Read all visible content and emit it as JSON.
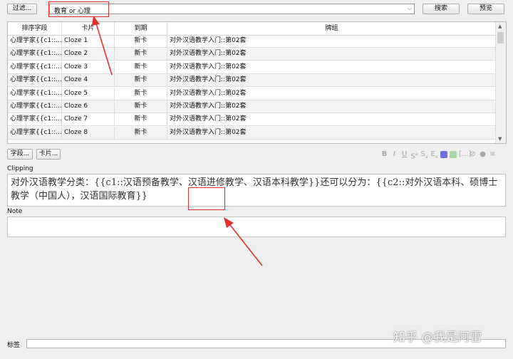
{
  "toolbar": {
    "filter_label": "过滤...",
    "search_value": "教育 or 心理",
    "search_button": "搜索",
    "preview_button": "预览"
  },
  "table": {
    "columns": [
      "排序字段",
      "卡片",
      "到期",
      "牌组"
    ],
    "rows": [
      {
        "sort": "心理学家{{c1::...",
        "card": "Cloze 1",
        "due": "新卡",
        "deck": "对外汉语教学入门::第02套"
      },
      {
        "sort": "心理学家{{c1::...",
        "card": "Cloze 2",
        "due": "新卡",
        "deck": "对外汉语教学入门::第02套"
      },
      {
        "sort": "心理学家{{c1::...",
        "card": "Cloze 3",
        "due": "新卡",
        "deck": "对外汉语教学入门::第02套"
      },
      {
        "sort": "心理学家{{c1::...",
        "card": "Cloze 4",
        "due": "新卡",
        "deck": "对外汉语教学入门::第02套"
      },
      {
        "sort": "心理学家{{c1::...",
        "card": "Cloze 5",
        "due": "新卡",
        "deck": "对外汉语教学入门::第02套"
      },
      {
        "sort": "心理学家{{c1::...",
        "card": "Cloze 6",
        "due": "新卡",
        "deck": "对外汉语教学入门::第02套"
      },
      {
        "sort": "心理学家{{c1::...",
        "card": "Cloze 7",
        "due": "新卡",
        "deck": "对外汉语教学入门::第02套"
      },
      {
        "sort": "心理学家{{c1::...",
        "card": "Cloze 8",
        "due": "新卡",
        "deck": "对外汉语教学入门::第02套"
      }
    ]
  },
  "editor": {
    "fields_button": "字段...",
    "cards_button": "卡片...",
    "clipping_label": "Clipping",
    "clipping_text": "对外汉语教学分类：{{c1::汉语预备教学、汉语进修教学、汉语本科教学}}还可以分为：{{c2::对外汉语本科、硕博士教学（中国人），汉语国际教育}}",
    "note_label": "Note",
    "tags_label": "标签"
  },
  "format_icons": [
    "bold-icon",
    "italic-icon",
    "underline-icon",
    "superscript-icon",
    "subscript-icon",
    "clear-format-icon",
    "text-color-icon",
    "highlight-color-icon",
    "cloze-icon",
    "attach-icon",
    "record-icon",
    "more-icon"
  ],
  "watermark": "知乎 @我是阿雷",
  "colors": {
    "annotation_red": "#e03030",
    "text_color_swatch": "#6f6fe0",
    "highlight_swatch": "#a8d8a8"
  }
}
